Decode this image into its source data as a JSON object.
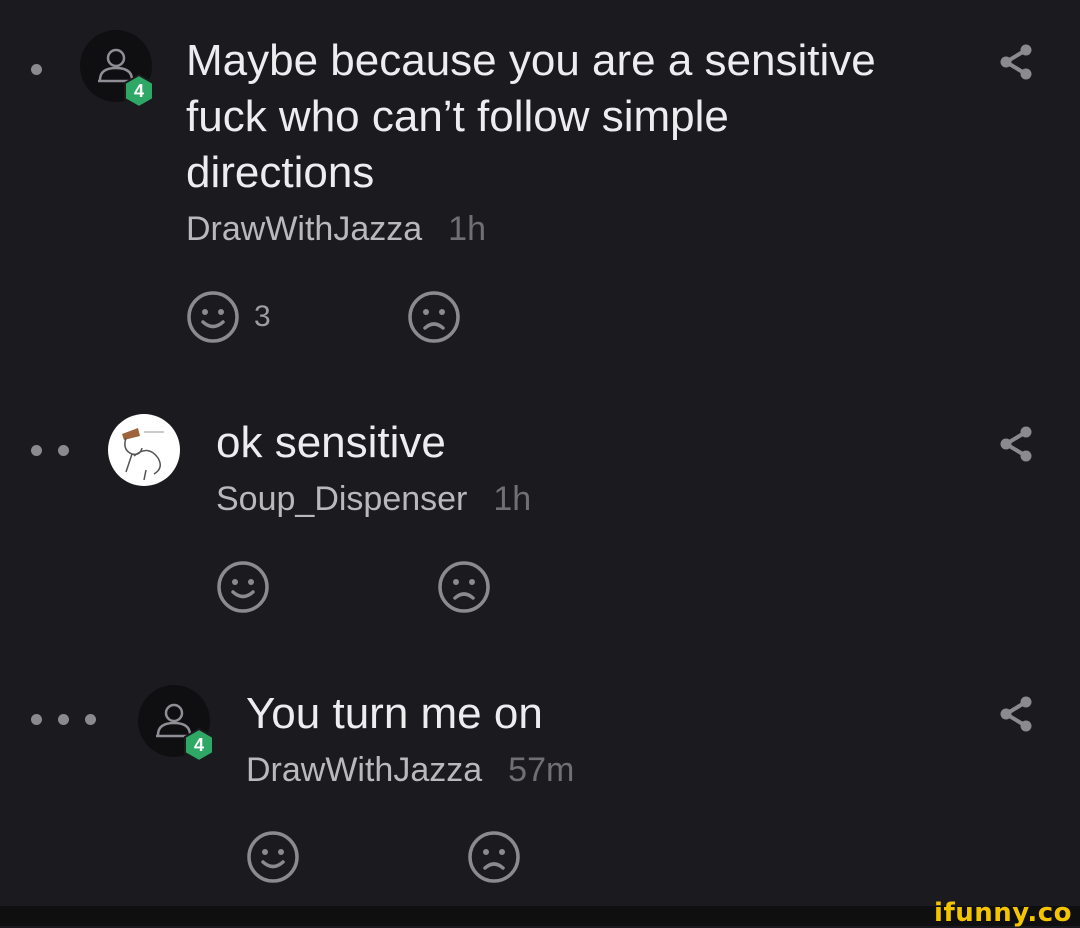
{
  "comments": [
    {
      "text": "Maybe because you are a sensitive fuck who can’t follow simple directions",
      "username": "DrawWithJazza",
      "time": "1h",
      "badge": "4",
      "likes": "3",
      "depth_dots": 1,
      "avatar": "default-user-icon"
    },
    {
      "text": "ok sensitive",
      "username": "Soup_Dispenser",
      "time": "1h",
      "likes": "",
      "depth_dots": 2,
      "avatar": "drawing-avatar"
    },
    {
      "text": "You turn me on",
      "username": "DrawWithJazza",
      "time": "57m",
      "badge": "4",
      "likes": "",
      "depth_dots": 3,
      "avatar": "default-user-icon"
    }
  ],
  "watermark": "ifunny.co",
  "colors": {
    "background": "#1b1b1f",
    "badge": "#2fa865",
    "watermark": "#f4c400"
  }
}
